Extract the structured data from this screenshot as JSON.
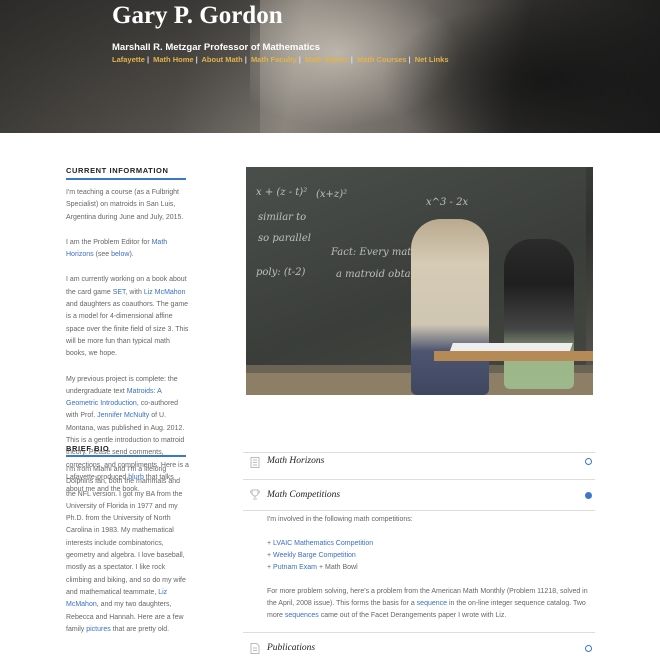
{
  "header": {
    "name": "Gary P. Gordon",
    "title": "Marshall R. Metzgar Professor of Mathematics",
    "links": [
      "Lafayette",
      "Math Home",
      "About Math",
      "Math Faculty",
      "Math Majors",
      "Math Courses",
      "Net Links"
    ],
    "link_color": "#e3b34a"
  },
  "current": {
    "heading": "CURRENT INFORMATION",
    "p1": "I'm teaching a course (as a Fulbright Specialist) on matroids in San Luis, Argentina during June and July, 2015.",
    "p2_pre": "I am the Problem Editor for ",
    "p2_link": "Math Horizons",
    "p2_mid": " (see ",
    "p2_link2": "below",
    "p2_post": ").",
    "p3_pre": "I am currently working on a book about the card game ",
    "p3_link1": "SET",
    "p3_mid1": ", with ",
    "p3_link2": "Liz McMahon",
    "p3_post": " and daughters as coauthors. The game is a model for 4-dimensional affine space over the finite field of size 3. This will be more fun than typical math books, we hope.",
    "p4_pre": "My previous project is complete: the undergraduate text ",
    "p4_link1": "Matroids: A Geometric Introduction",
    "p4_mid1": ", co-authored with Prof. ",
    "p4_link2": "Jennifer McNulty",
    "p4_mid2": " of U. Montana, was published in Aug. 2012. This is a gentle introduction to matroid theory. Please send comments, corrections, and compliments. Here is a Lafayette-produced ",
    "p4_link3": "blurb",
    "p4_post": " that talks about me and the book."
  },
  "bio": {
    "heading": "BRIEF BIO",
    "text_pre": "I'm from Miami and I'm a lifelong Dolphins fan, both the mammals and the NFL version. I got my BA from the University of Florida in 1977 and my Ph.D. from the University of North Carolina in 1983. My mathematical interests include combinatorics, geometry and algebra. I love baseball, mostly as a spectator. I like rock climbing and biking, and so do my wife and mathematical teammate, ",
    "link1": "Liz McMahon",
    "text_mid": ", and my two daughters, Rebecca and Hannah. Here are a few family ",
    "link2": "pictures",
    "text_post": " that are pretty old."
  },
  "photo": {
    "chalk": [
      "x + (z - t)²",
      "similar to",
      "(x+z)²",
      "so parallel",
      "Fact: Every matroid is",
      "a matroid obtained",
      "poly: (t-2)",
      "x^3 - 2x"
    ]
  },
  "accordion": {
    "items": [
      {
        "title": "Math Horizons",
        "icon": "book-icon",
        "open": false
      },
      {
        "title": "Math Competitions",
        "icon": "trophy-icon",
        "open": true
      },
      {
        "title": "Publications",
        "icon": "document-icon",
        "open": false
      }
    ],
    "competitions": {
      "intro": "I'm involved in the following math competitions:",
      "list": [
        {
          "link": "LVAIC Mathematics Competition",
          "suffix": ""
        },
        {
          "link": "Weekly Barge Competition",
          "suffix": ""
        },
        {
          "link": "Putnam Exam",
          "suffix": " + Math Bowl"
        }
      ],
      "bullet": "+ ",
      "para_pre": "For more problem solving, here's a problem from the American Math Monthly (Problem 11218, solved in the April, 2008 issue). This forms the basis for a ",
      "para_link1": "sequence",
      "para_mid": " in the on-line integer sequence catalog. Two more ",
      "para_link2": "sequences",
      "para_post": " came out of the Facet Derangements paper I wrote with Liz."
    }
  },
  "colors": {
    "accent": "#3a78c9",
    "link": "#3a6fc4"
  }
}
